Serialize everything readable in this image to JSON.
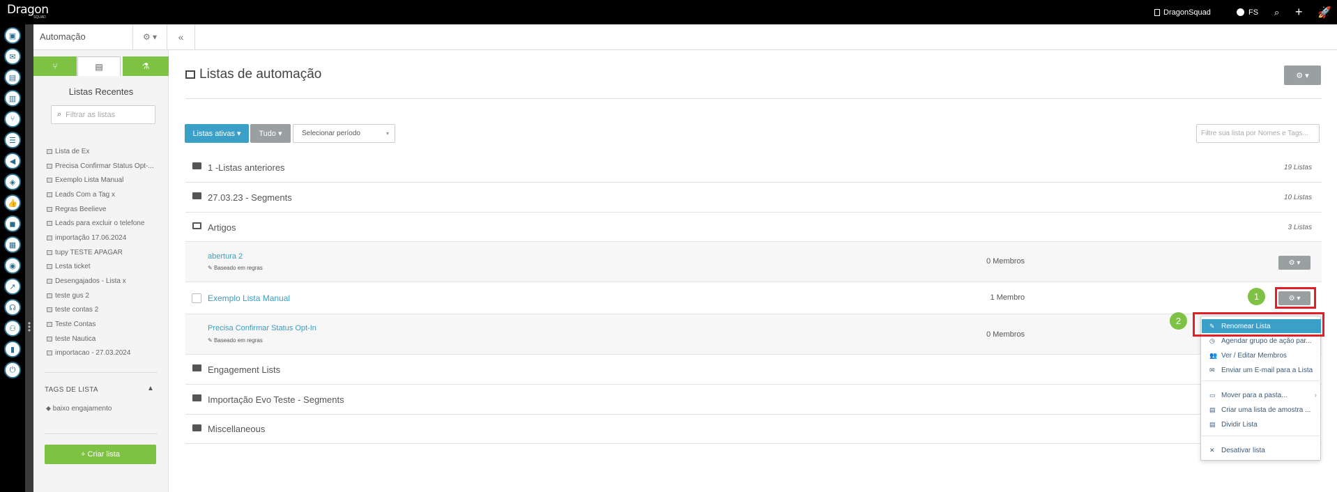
{
  "topbar": {
    "logo": "Dragon",
    "logo_sub": "SQUAD",
    "company_icon": "building-icon",
    "company": "DragonSquad",
    "user_icon": "user-icon",
    "user_initials": "FS",
    "search_icon": "search-icon",
    "add_icon": "plus-icon",
    "rocket_icon": "rocket-icon"
  },
  "rail": {
    "icons": [
      "contacts-icon",
      "inbox-icon",
      "clipboard-icon",
      "map-icon",
      "automation-icon",
      "list-icon",
      "megaphone-icon",
      "shield-icon",
      "thumbs-up-icon",
      "chat-icon",
      "calendar-icon",
      "eye-icon",
      "chart-icon",
      "support-icon",
      "user-plus-icon",
      "bar-chart-icon",
      "power-icon"
    ]
  },
  "section": {
    "title": "Automação",
    "gear_label": "⚙ ▾",
    "collapse_label": "«"
  },
  "left_panel": {
    "tabs": [
      {
        "icon": "branch-icon",
        "glyph": "⑂"
      },
      {
        "icon": "list-icon",
        "glyph": "▤"
      },
      {
        "icon": "flask-icon",
        "glyph": "⚗"
      }
    ],
    "recent_title": "Listas Recentes",
    "filter_placeholder": "Filtrar as listas",
    "recent_lists": [
      "Lista de Ex",
      "Precisa Confirmar Status Opt-...",
      "Exemplo Lista Manual",
      "Leads Com a Tag x",
      "Regras Beelieve",
      "Leads para excluir o telefone",
      "importação 17.06.2024",
      "tupy TESTE APAGAR",
      "Lesta ticket",
      "Desengajados - Lista x",
      "teste gus 2",
      "teste contas 2",
      "Teste Contas",
      "teste Nautica",
      "importacao - 27.03.2024"
    ],
    "tags_title": "TAGS DE LISTA",
    "tags_caret": "▲",
    "tag_item": "baixo engajamento",
    "create_button": "+  Criar lista"
  },
  "main": {
    "title": "Listas de automação",
    "gear_label": "⚙ ▾",
    "buttons": {
      "active_lists": "Listas ativas ▾",
      "all": "Tudo ▾",
      "period_placeholder": "Selecionar período"
    },
    "filter_placeholder": "Filtre sua lista por Nomes e Tags...",
    "folders": [
      {
        "name": "1 -Listas anteriores",
        "count": "19 Listas"
      },
      {
        "name": "27.03.23 - Segments",
        "count": "10 Listas"
      },
      {
        "name": "Artigos",
        "count": "3 Listas"
      }
    ],
    "lists": [
      {
        "name": "abertura 2",
        "sub": "Baseado em regras",
        "members": "0 Membros"
      },
      {
        "name": "Exemplo Lista Manual",
        "sub": "",
        "members": "1 Membro"
      },
      {
        "name": "Precisa Confirmar Status Opt-In",
        "sub": "Baseado em regras",
        "members": "0 Membros"
      }
    ],
    "folders_after": [
      {
        "name": "Engagement Lists"
      },
      {
        "name": "Importação Evo Teste - Segments"
      },
      {
        "name": "Miscellaneous"
      }
    ],
    "row_gear_label": "⚙ ▾"
  },
  "menu": {
    "items": [
      {
        "label": "Renomear Lista",
        "icon": "pencil-icon",
        "glyph": "✎"
      },
      {
        "label": "Agendar grupo de ação par...",
        "icon": "clock-icon",
        "glyph": "◷"
      },
      {
        "label": "Ver / Editar Membros",
        "icon": "users-icon",
        "glyph": "👥"
      },
      {
        "label": "Enviar um E-mail para a Lista",
        "icon": "envelope-icon",
        "glyph": "✉"
      },
      {
        "label": "Mover para a pasta...",
        "icon": "folder-open-icon",
        "glyph": "▭"
      },
      {
        "label": "Criar uma lista de amostra ...",
        "icon": "list-icon",
        "glyph": "▤"
      },
      {
        "label": "Dividir Lista",
        "icon": "list-icon",
        "glyph": "▤"
      },
      {
        "label": "Desativar lista",
        "icon": "close-icon",
        "glyph": "✕"
      }
    ],
    "submenu_caret": "›"
  },
  "annotations": {
    "step1": "1",
    "step2": "2"
  },
  "colors": {
    "green": "#7dc242",
    "blue_button": "#3aa0c8",
    "gray_button": "#9aa0a2",
    "annotation_red": "#e41e26",
    "link_blue": "#3a9cc0"
  }
}
